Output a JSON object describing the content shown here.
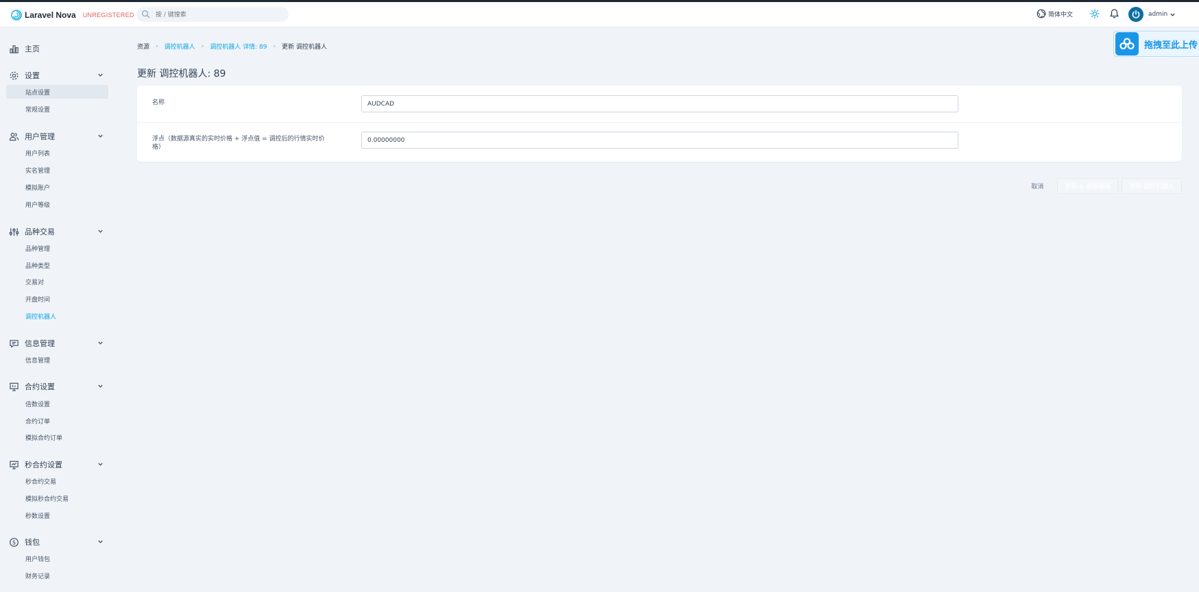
{
  "app": {
    "brand": "Laravel Nova",
    "badge": "UNREGISTERED"
  },
  "search": {
    "placeholder": "按 / 键搜索",
    "icon": "search-icon"
  },
  "header": {
    "language": "简体中文",
    "user": "admin",
    "icons": [
      "globe-icon",
      "sun-icon",
      "bell-icon",
      "power-icon"
    ]
  },
  "sidebar": {
    "home": "主页",
    "groups": [
      {
        "title": "设置",
        "icon": "gear-icon",
        "items": [
          "站点设置",
          "常规设置"
        ]
      },
      {
        "title": "用户管理",
        "icon": "users-icon",
        "items": [
          "用户列表",
          "实名管理",
          "模拟账户",
          "用户等级"
        ]
      },
      {
        "title": "品种交易",
        "icon": "sliders-icon",
        "items": [
          "品种管理",
          "品种类型",
          "交易对",
          "开盘时间",
          "调控机器人"
        ]
      },
      {
        "title": "信息管理",
        "icon": "message-icon",
        "items": [
          "信息管理"
        ]
      },
      {
        "title": "合约设置",
        "icon": "presentation-icon",
        "items": [
          "倍数设置",
          "合约订单",
          "模拟合约订单"
        ]
      },
      {
        "title": "秒合约设置",
        "icon": "presentation-chart-icon",
        "items": [
          "秒合约交易",
          "模拟秒合约交易",
          "秒数设置"
        ]
      },
      {
        "title": "钱包",
        "icon": "dollar-icon",
        "items": [
          "用户钱包",
          "财务记录"
        ]
      }
    ]
  },
  "breadcrumb": [
    "资源",
    "调控机器人",
    "调控机器人 详情: 89",
    "更新 调控机器人"
  ],
  "page": {
    "title": "更新 调控机器人: 89"
  },
  "form": {
    "fields": [
      {
        "label": "名称",
        "value": "AUDCAD"
      },
      {
        "label": "浮点（数据源真实的实时价格 + 浮点值 = 调控后的行情实时价格）",
        "value": "0.00000000"
      }
    ]
  },
  "actions": {
    "cancel": "取消",
    "update_continue": "更新 & 继续编辑",
    "update": "更新 调控机器人"
  },
  "upload_widget": {
    "label": "拖拽至此上传"
  },
  "colors": {
    "accent": "#0ea5e9",
    "badge": "#e25b5b",
    "upload": "#1a96e6"
  }
}
